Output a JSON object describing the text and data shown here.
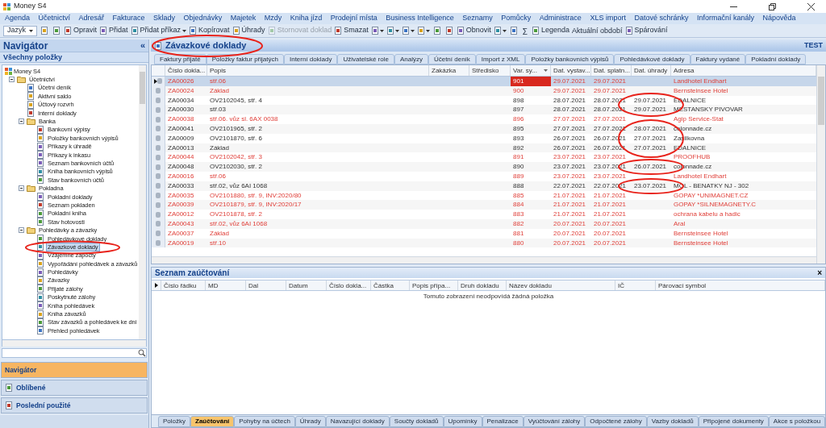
{
  "window": {
    "title": "Money S4"
  },
  "menu": [
    "Agenda",
    "Účetnictví",
    "Adresář",
    "Fakturace",
    "Sklady",
    "Objednávky",
    "Majetek",
    "Mzdy",
    "Kniha jízd",
    "Prodejní místa",
    "Business Intelligence",
    "Seznamy",
    "Pomůcky",
    "Administrace",
    "XLS import",
    "Datové schránky",
    "Informační kanály",
    "Nápověda"
  ],
  "toolbar": [
    {
      "kind": "dropdown",
      "label": "Jazyk",
      "disabled": false
    },
    {
      "kind": "icon",
      "disabled": false
    },
    {
      "kind": "icon",
      "disabled": false
    },
    {
      "kind": "button",
      "label": "Opravit",
      "disabled": false
    },
    {
      "kind": "button",
      "label": "Přidat",
      "disabled": false
    },
    {
      "kind": "dropdown-button",
      "label": "Přidat příkaz",
      "disabled": false
    },
    {
      "kind": "button",
      "label": "Kopírovat",
      "disabled": false
    },
    {
      "kind": "button",
      "label": "Úhrady",
      "disabled": false
    },
    {
      "kind": "button",
      "label": "Stornovat doklad",
      "disabled": true
    },
    {
      "kind": "button",
      "label": "Smazat",
      "disabled": false
    },
    {
      "kind": "icon-dropdown",
      "disabled": false
    },
    {
      "kind": "icon-dropdown",
      "disabled": false
    },
    {
      "kind": "icon-dropdown",
      "disabled": false
    },
    {
      "kind": "icon-dropdown",
      "disabled": false
    },
    {
      "kind": "icon",
      "disabled": false
    },
    {
      "kind": "icon",
      "disabled": false
    },
    {
      "kind": "button",
      "label": "Obnovit",
      "disabled": false
    },
    {
      "kind": "icon-dropdown",
      "disabled": false
    },
    {
      "kind": "icon",
      "disabled": false
    },
    {
      "kind": "symbol",
      "label": "Σ",
      "disabled": false
    },
    {
      "kind": "button",
      "label": "Legenda",
      "disabled": false
    },
    {
      "kind": "text",
      "label": "Aktuální období",
      "disabled": false
    },
    {
      "kind": "button",
      "label": "Spárování",
      "disabled": false
    }
  ],
  "navigator": {
    "title": "Navigátor",
    "collapse": "«",
    "filter": "Všechny položky",
    "tree": {
      "label": "Money S4",
      "children": [
        {
          "label": "Účetnictví",
          "expanded": true,
          "selected": false,
          "children": [
            {
              "label": "Účetní deník",
              "selected": false
            },
            {
              "label": "Aktivní saldo",
              "selected": false
            },
            {
              "label": "Účtový rozvrh",
              "selected": false
            },
            {
              "label": "Interní doklady",
              "selected": false
            },
            {
              "label": "Banka",
              "expanded": true,
              "selected": false,
              "children": [
                {
                  "label": "Bankovní výpisy",
                  "selected": false
                },
                {
                  "label": "Položky bankovních výpisů",
                  "selected": false
                },
                {
                  "label": "Příkazy k úhradě",
                  "selected": false
                },
                {
                  "label": "Příkazy k inkasu",
                  "selected": false
                },
                {
                  "label": "Seznam bankovních účtů",
                  "selected": false
                },
                {
                  "label": "Kniha bankovních výpisů",
                  "selected": false
                },
                {
                  "label": "Stav bankovních účtů",
                  "selected": false
                }
              ]
            },
            {
              "label": "Pokladna",
              "expanded": true,
              "selected": false,
              "children": [
                {
                  "label": "Pokladní doklady",
                  "selected": false
                },
                {
                  "label": "Seznam pokladen",
                  "selected": false
                },
                {
                  "label": "Pokladní kniha",
                  "selected": false
                },
                {
                  "label": "Stav hotovosti",
                  "selected": false
                }
              ]
            },
            {
              "label": "Pohledávky a závazky",
              "expanded": true,
              "selected": false,
              "children": [
                {
                  "label": "Pohledávkové doklady",
                  "selected": false
                },
                {
                  "label": "Závazkové doklady",
                  "selected": true
                },
                {
                  "label": "Vzájemné zápočty",
                  "selected": false
                },
                {
                  "label": "Vypořádání pohledávek a závazků",
                  "selected": false
                },
                {
                  "label": "Pohledávky",
                  "selected": false
                },
                {
                  "label": "Závazky",
                  "selected": false
                },
                {
                  "label": "Přijaté zálohy",
                  "selected": false
                },
                {
                  "label": "Poskytnuté zálohy",
                  "selected": false
                },
                {
                  "label": "Kniha pohledávek",
                  "selected": false
                },
                {
                  "label": "Kniha závazků",
                  "selected": false
                },
                {
                  "label": "Stav závazků a pohledávek ke dni",
                  "selected": false
                },
                {
                  "label": "Přehled pohledávek",
                  "selected": false
                }
              ]
            }
          ]
        }
      ]
    },
    "panels": [
      {
        "label": "Navigátor",
        "selected": true
      },
      {
        "label": "Oblíbené",
        "selected": false
      },
      {
        "label": "Poslední použité",
        "selected": false
      }
    ]
  },
  "agenda": {
    "title": "Závazkové doklady",
    "database": "TEST",
    "tabs": [
      {
        "label": "Faktury přijaté",
        "selected": false
      },
      {
        "label": "Položky faktur přijatých",
        "selected": false
      },
      {
        "label": "Interní doklady",
        "selected": false
      },
      {
        "label": "Uživatelské role",
        "selected": false
      },
      {
        "label": "Analýzy",
        "selected": false
      },
      {
        "label": "Účetní deník",
        "selected": false
      },
      {
        "label": "Import z XML",
        "selected": false
      },
      {
        "label": "Položky bankovních výpisů",
        "selected": false
      },
      {
        "label": "Pohledávkové doklady",
        "selected": false
      },
      {
        "label": "Faktury vydané",
        "selected": false
      },
      {
        "label": "Pokladní doklady",
        "selected": false
      }
    ],
    "table": {
      "columns": [
        "Číslo dokla...",
        "Popis",
        "Zakázka",
        "Středisko",
        "Var. sy...",
        "Dat. vystav...",
        "Dat. splatn...",
        "Dat. úhrady",
        "Adresa"
      ],
      "rows": [
        {
          "number": "ZA00026",
          "description": "stř.06",
          "var_symbol": "901",
          "issued": "29.07.2021",
          "due": "29.07.2021",
          "paid": "",
          "address": "Landhotel Endhart",
          "unpaid": true,
          "selected": true
        },
        {
          "number": "ZA00024",
          "description": "Základ",
          "var_symbol": "900",
          "issued": "29.07.2021",
          "due": "29.07.2021",
          "paid": "",
          "address": "Bernsteinsee Hotel",
          "unpaid": true,
          "selected": false
        },
        {
          "number": "ZA00034",
          "description": "OV2102045, stř. 4",
          "var_symbol": "898",
          "issued": "28.07.2021",
          "due": "28.07.2021",
          "paid": "29.07.2021",
          "address": "EDALNICE",
          "unpaid": false,
          "selected": false
        },
        {
          "number": "ZA00030",
          "description": "stř.03",
          "var_symbol": "897",
          "issued": "28.07.2021",
          "due": "28.07.2021",
          "paid": "29.07.2021",
          "address": "MESTANSKY PIVOVAR",
          "unpaid": false,
          "selected": false
        },
        {
          "number": "ZA00038",
          "description": "stř.06. vůz sl. 6AX 0038",
          "var_symbol": "896",
          "issued": "27.07.2021",
          "due": "27.07.2021",
          "paid": "",
          "address": "Agip Service-Stat",
          "unpaid": true,
          "selected": false
        },
        {
          "number": "ZA00041",
          "description": "OV2101965, stř. 2",
          "var_symbol": "895",
          "issued": "27.07.2021",
          "due": "27.07.2021",
          "paid": "28.07.2021",
          "address": "colonnade.cz",
          "unpaid": false,
          "selected": false
        },
        {
          "number": "ZA00009",
          "description": "OV2101870, stř. 6",
          "var_symbol": "893",
          "issued": "26.07.2021",
          "due": "26.07.2021",
          "paid": "27.07.2021",
          "address": "Zasilkovna",
          "unpaid": false,
          "selected": false
        },
        {
          "number": "ZA00013",
          "description": "Základ",
          "var_symbol": "892",
          "issued": "26.07.2021",
          "due": "26.07.2021",
          "paid": "27.07.2021",
          "address": "EDALNICE",
          "unpaid": false,
          "selected": false
        },
        {
          "number": "ZA00044",
          "description": "OV2102042, stř. 3",
          "var_symbol": "891",
          "issued": "23.07.2021",
          "due": "23.07.2021",
          "paid": "",
          "address": "PROOFHUB",
          "unpaid": true,
          "selected": false
        },
        {
          "number": "ZA00048",
          "description": "OV2102030, stř. 2",
          "var_symbol": "890",
          "issued": "23.07.2021",
          "due": "23.07.2021",
          "paid": "26.07.2021",
          "address": "colonnade.cz",
          "unpaid": false,
          "selected": false
        },
        {
          "number": "ZA00016",
          "description": "stř.06",
          "var_symbol": "889",
          "issued": "23.07.2021",
          "due": "23.07.2021",
          "paid": "",
          "address": "Landhotel Endhart",
          "unpaid": true,
          "selected": false
        },
        {
          "number": "ZA00033",
          "description": "stř.02, vůz 6AI 1068",
          "var_symbol": "888",
          "issued": "22.07.2021",
          "due": "22.07.2021",
          "paid": "23.07.2021",
          "address": "MOL - BENATKY NJ - 302",
          "unpaid": false,
          "selected": false
        },
        {
          "number": "ZA00035",
          "description": "OV2101880, stř. 9, INV:2020/80",
          "var_symbol": "885",
          "issued": "21.07.2021",
          "due": "21.07.2021",
          "paid": "",
          "address": "GOPAY  *UNIMAGNET.CZ",
          "unpaid": true,
          "selected": false
        },
        {
          "number": "ZA00039",
          "description": "OV2101879, stř. 9, INV:2020/17",
          "var_symbol": "884",
          "issued": "21.07.2021",
          "due": "21.07.2021",
          "paid": "",
          "address": "GOPAY  *SILNEMAGNETY.C",
          "unpaid": true,
          "selected": false
        },
        {
          "number": "ZA00012",
          "description": "OV2101878, stř. 2",
          "var_symbol": "883",
          "issued": "21.07.2021",
          "due": "21.07.2021",
          "paid": "",
          "address": "ochrana kabelu a hadic",
          "unpaid": true,
          "selected": false
        },
        {
          "number": "ZA00043",
          "description": "stř.02, vůz 6AI 1068",
          "var_symbol": "882",
          "issued": "20.07.2021",
          "due": "20.07.2021",
          "paid": "",
          "address": "Aral",
          "unpaid": true,
          "selected": false
        },
        {
          "number": "ZA00037",
          "description": "Základ",
          "var_symbol": "881",
          "issued": "20.07.2021",
          "due": "20.07.2021",
          "paid": "",
          "address": "Bernsteinsee Hotel",
          "unpaid": true,
          "selected": false
        },
        {
          "number": "ZA00019",
          "description": "stř.10",
          "var_symbol": "880",
          "issued": "20.07.2021",
          "due": "20.07.2021",
          "paid": "",
          "address": "Bernsteinsee Hotel",
          "unpaid": true,
          "selected": false
        }
      ]
    }
  },
  "postings": {
    "title": "Seznam zaúčtování",
    "close": "×",
    "columns": [
      "Číslo řádku",
      "MD",
      "Dal",
      "Datum",
      "Číslo dokla...",
      "Částka",
      "Popis přípa...",
      "Druh dokladu",
      "Název dokladu",
      "IČ",
      "Párovací symbol"
    ],
    "empty_message": "Tomuto zobrazení neodpovídá žádná položka",
    "tabs": [
      {
        "label": "Položky",
        "selected": false
      },
      {
        "label": "Zaúčtování",
        "selected": true
      },
      {
        "label": "Pohyby na účtech",
        "selected": false
      },
      {
        "label": "Úhrady",
        "selected": false
      },
      {
        "label": "Navazující doklady",
        "selected": false
      },
      {
        "label": "Součty dokladů",
        "selected": false
      },
      {
        "label": "Upomínky",
        "selected": false
      },
      {
        "label": "Penalizace",
        "selected": false
      },
      {
        "label": "Vyúčtování zálohy",
        "selected": false
      },
      {
        "label": "Odpočtené zálohy",
        "selected": false
      },
      {
        "label": "Vazby dokladů",
        "selected": false
      },
      {
        "label": "Připojené dokumenty",
        "selected": false
      },
      {
        "label": "Akce s položkou",
        "selected": false
      }
    ]
  }
}
